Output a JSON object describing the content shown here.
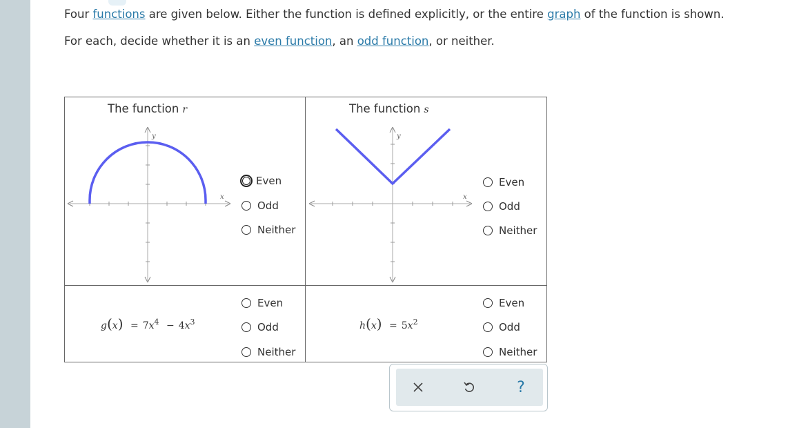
{
  "instructions": {
    "line1": {
      "t1": "Four ",
      "link1": "functions",
      "t2": " are given below. Either the function is defined explicitly, or the entire ",
      "link2": "graph",
      "t3": " of the function is shown."
    },
    "line2": {
      "t1": "For each, decide whether it is an ",
      "link1": "even function",
      "t2": ", an ",
      "link2": "odd function",
      "t3": ", or neither."
    }
  },
  "panels": {
    "r": {
      "title": "The function",
      "fname": "r",
      "axis_x": "x",
      "axis_y": "y",
      "curve": "upper semicircle of radius 3 centered at origin",
      "options": [
        "Even",
        "Odd",
        "Neither"
      ],
      "focused_option": "Even"
    },
    "s": {
      "title": "The function",
      "fname": "s",
      "axis_x": "x",
      "axis_y": "y",
      "curve": "absolute value V-shape with vertex at origin",
      "options": [
        "Even",
        "Odd",
        "Neither"
      ]
    },
    "g": {
      "fname": "g",
      "var": "x",
      "eq": "=",
      "coef1": "7",
      "pow1": "4",
      "op": "−",
      "coef2": "4",
      "pow2": "3",
      "options": [
        "Even",
        "Odd",
        "Neither"
      ]
    },
    "h": {
      "fname": "h",
      "var": "x",
      "eq": "=",
      "coef1": "5",
      "pow1": "2",
      "options": [
        "Even",
        "Odd",
        "Neither"
      ]
    }
  },
  "colors": {
    "curve": "#5b5ef0",
    "link": "#2a7aa8"
  },
  "toolbar": {
    "buttons": [
      "close-icon",
      "undo-icon",
      "help-icon"
    ],
    "help_label": "?"
  }
}
